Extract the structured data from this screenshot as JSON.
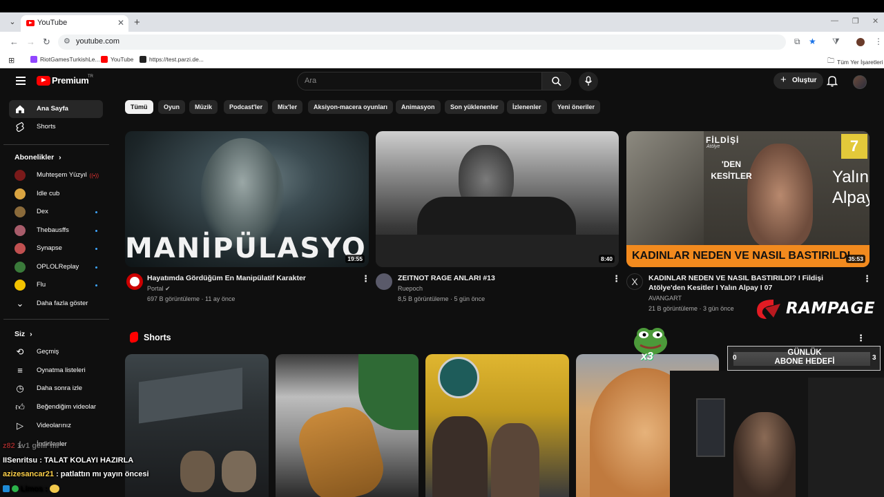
{
  "browser": {
    "tab_title": "YouTube",
    "url": "youtube.com",
    "bookmarks": [
      "RiotGamesTurkishLe...",
      "YouTube",
      "https://test.parzi.de..."
    ],
    "all_bookmarks": "Tüm Yer İşaretleri"
  },
  "header": {
    "logo_text": "Premium",
    "logo_region": "TR",
    "search_placeholder": "Ara",
    "create_label": "Oluştur"
  },
  "sidebar": {
    "main": [
      {
        "label": "Ana Sayfa",
        "icon": "home-icon"
      },
      {
        "label": "Shorts",
        "icon": "shorts-icon"
      }
    ],
    "subs_heading": "Abonelikler",
    "subscriptions": [
      {
        "label": "Muhteşem Yüzyıl",
        "color": "#7a1a1a"
      },
      {
        "label": "Idle cub",
        "color": "#d9a441"
      },
      {
        "label": "Dex",
        "color": "#8a6a3a"
      },
      {
        "label": "Thebausffs",
        "color": "#a85c6a"
      },
      {
        "label": "Synapse",
        "color": "#c05050"
      },
      {
        "label": "OPLOLReplay",
        "color": "#3a7a3a"
      },
      {
        "label": "Flu",
        "color": "#f2c200"
      }
    ],
    "show_more": "Daha fazla göster",
    "you_heading": "Siz",
    "you_items": [
      {
        "label": "Geçmiş",
        "icon": "history-icon"
      },
      {
        "label": "Oynatma listeleri",
        "icon": "playlists-icon"
      },
      {
        "label": "Daha sonra izle",
        "icon": "watch-later-icon"
      },
      {
        "label": "Beğendiğim videolar",
        "icon": "like-icon"
      },
      {
        "label": "Videolarınız",
        "icon": "your-videos-icon"
      },
      {
        "label": "İndirilenler",
        "icon": "download-icon"
      }
    ]
  },
  "chips": [
    "Tümü",
    "Oyun",
    "Müzik",
    "Podcast'ler",
    "Mix'ler",
    "Aksiyon-macera oyunları",
    "Animasyon",
    "Son yüklenenler",
    "İzlenenler",
    "Yeni öneriler"
  ],
  "videos": [
    {
      "title": "Hayatımda Gördüğüm En Manipülatif Karakter",
      "channel": "Portal",
      "meta": "697 B görüntüleme · 11 ay önce",
      "duration": "19:55",
      "thumb_text": "MANİPÜLASYON"
    },
    {
      "title": "ZEITNOT RAGE ANLARI #13",
      "channel": "Ruepoch",
      "meta": "8,5 B görüntüleme · 5 gün önce",
      "duration": "8:40"
    },
    {
      "title": "KADINLAR NEDEN VE NASIL BASTIRILDI? I Fildişi Atölye'den Kesitler I Yalın Alpay I 07",
      "channel": "AVANGART",
      "meta": "21 B görüntüleme · 3 gün önce",
      "duration": "35:53",
      "thumb_banner": "KADINLAR NEDEN VE NASIL BASTIRILDI",
      "thumb_brand": "FİLDİŞİ",
      "thumb_brand_sub": "Atölye",
      "thumb_den": "'DEN KESİTLER",
      "thumb_name": "Yalın Alpay",
      "thumb_number": "7"
    }
  ],
  "shorts_heading": "Shorts",
  "overlay": {
    "sponsor": "RAMPAGE",
    "goal_title": "GÜNLÜK ABONE HEDEFİ",
    "goal_current": "0",
    "goal_target": "3",
    "emote_text": "x3",
    "chat": [
      {
        "user": "IISenritsu",
        "msg": ": TALAT KOLAYI HAZIRLA",
        "color": "#ffffff"
      },
      {
        "user": "azizesancar21",
        "msg": ": patlattın mı yayın öncesi",
        "color": "#ffd24a"
      },
      {
        "user": "Limos",
        "msg": ":",
        "color": "#ffffff"
      }
    ],
    "chat_faded": "1v1 gelir mi"
  }
}
